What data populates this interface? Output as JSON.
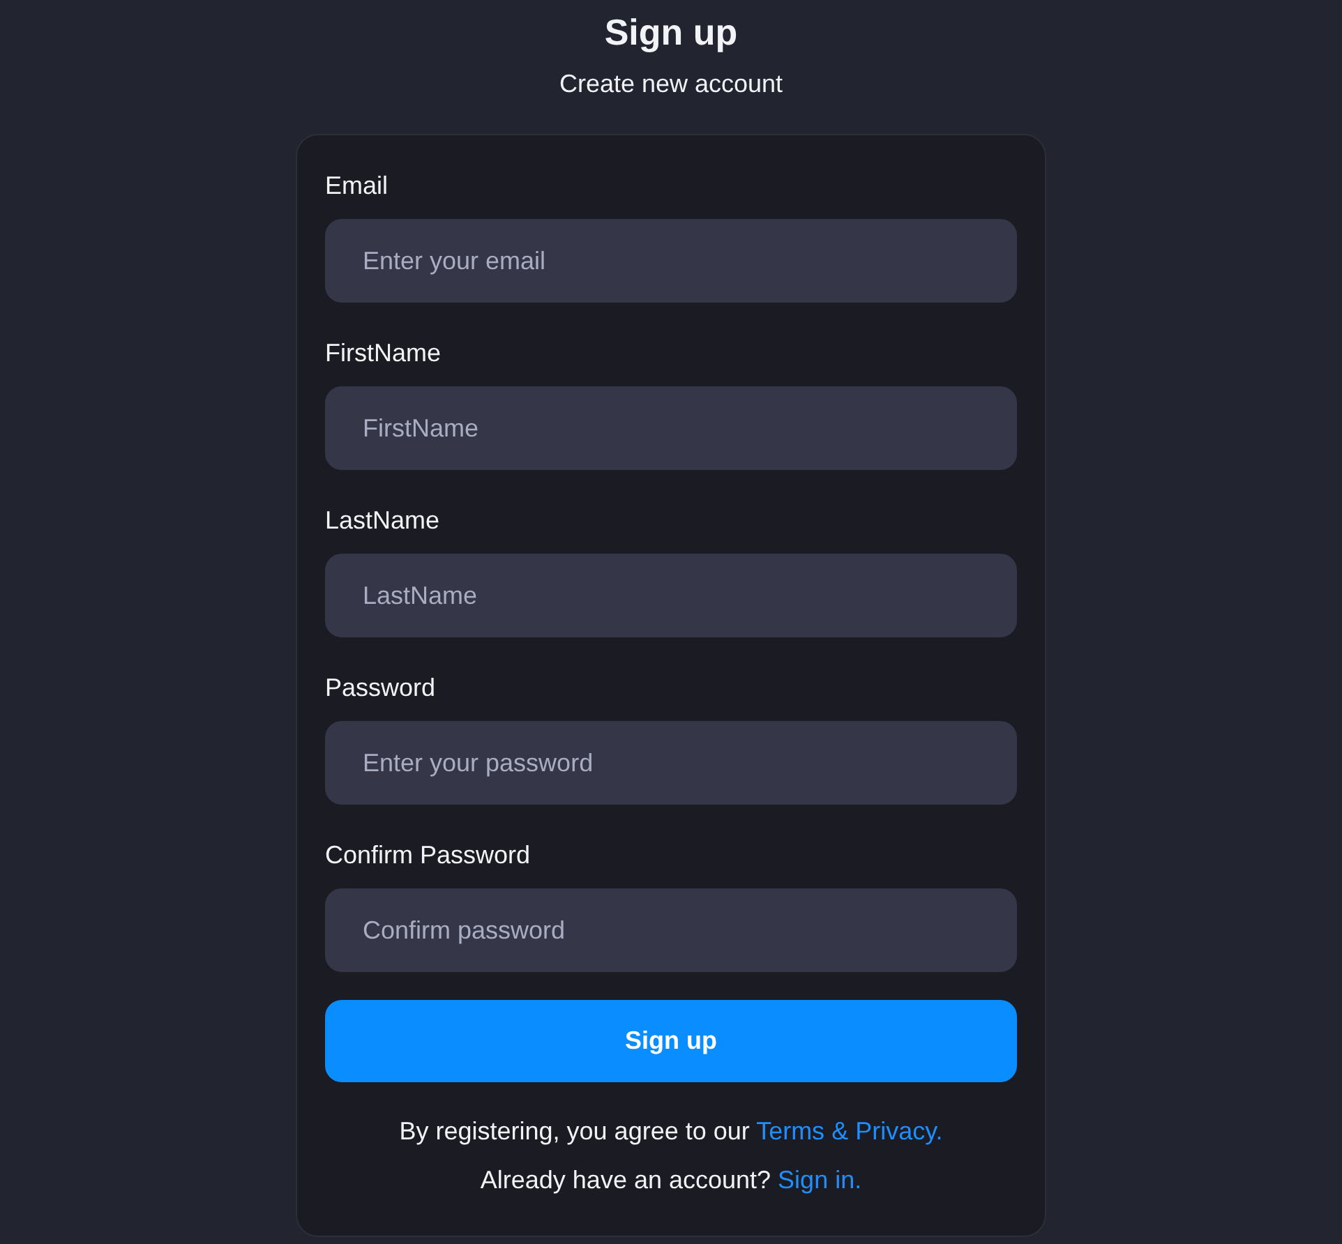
{
  "title": "Sign up",
  "subtitle": "Create new account",
  "fields": [
    {
      "label": "Email",
      "placeholder": "Enter your email"
    },
    {
      "label": "FirstName",
      "placeholder": "FirstName"
    },
    {
      "label": "LastName",
      "placeholder": "LastName"
    },
    {
      "label": "Password",
      "placeholder": "Enter your password"
    },
    {
      "label": "Confirm Password",
      "placeholder": "Confirm password"
    }
  ],
  "button": "Sign up",
  "footer": [
    {
      "text": "By registering, you agree to our ",
      "link": "Terms & Privacy."
    },
    {
      "text": "Already have an account? ",
      "link": "Sign in."
    }
  ]
}
